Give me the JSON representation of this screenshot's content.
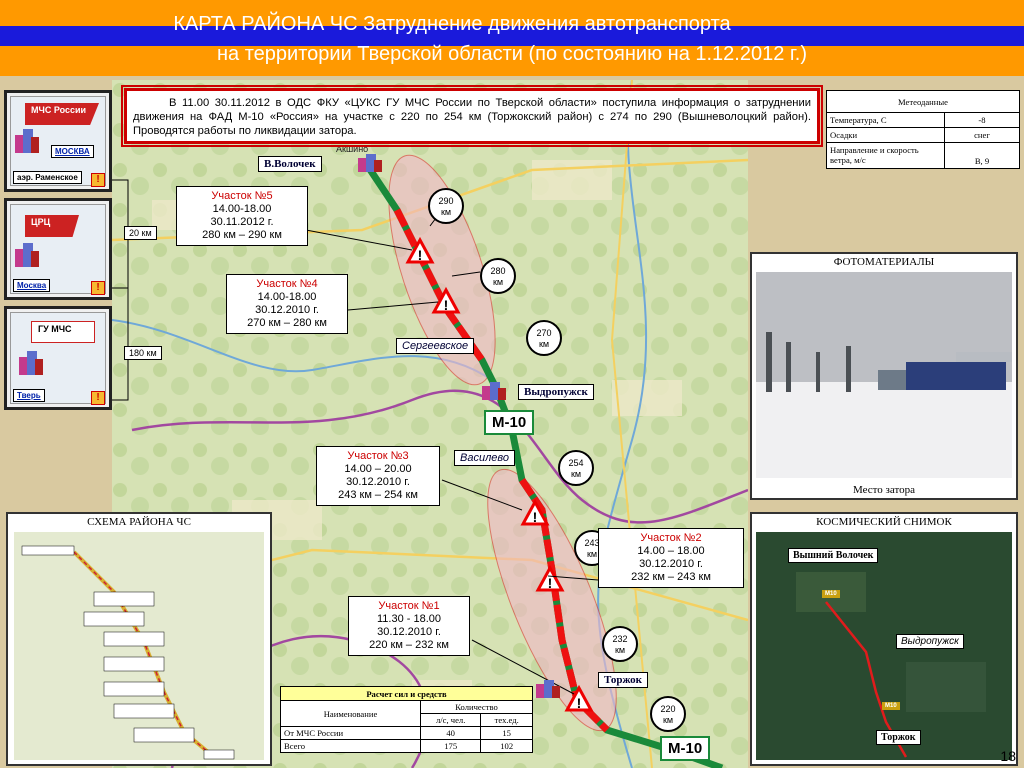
{
  "header": {
    "title_line1": "КАРТА РАЙОНА ЧС Затруднение движения автотранспорта",
    "title_line2": "на территории Тверской области (по состоянию на 1.12.2012 г.)"
  },
  "info_text": "В 11.00 30.11.2012 в ОДС ФКУ «ЦУКС ГУ МЧС России по Тверской  области» поступила информация о затруднении движения на ФАД М-10 «Россия» на участке с 220 по 254 км (Торжокский район) с 274 по 290 (Вышневолоцкий район). Проводятся работы по ликвидации затора.",
  "meteo": {
    "title": "Метеоданные",
    "rows": [
      {
        "label": "Температура, С",
        "value": "-8"
      },
      {
        "label": "Осадки",
        "value": "снег"
      },
      {
        "label": "Направление и скорость ветра, м/с",
        "value": "В, 9"
      }
    ]
  },
  "org_chain": {
    "box1": {
      "flag": "МЧС России",
      "place": "МОСКВА",
      "airport": "аэр. Раменское"
    },
    "box2": {
      "flag": "ЦРЦ",
      "place": "Москва"
    },
    "box3": {
      "flag": "ГУ МЧС",
      "place": "Тверь"
    },
    "dist1": "20 км",
    "dist2": "180 км",
    "warn_glyph": "!"
  },
  "map": {
    "towns": {
      "volochek": "В.Волочек",
      "sergeevskoe": "Сергеевское",
      "vydropuzhsk": "Выдропужск",
      "vasilevo": "Василево",
      "torzhok": "Торжок",
      "akshino": "Акшино"
    },
    "road_label": "М-10",
    "km_markers": [
      {
        "line1": "290",
        "line2": "км"
      },
      {
        "line1": "280",
        "line2": "км"
      },
      {
        "line1": "270",
        "line2": "км"
      },
      {
        "line1": "254",
        "line2": "км"
      },
      {
        "line1": "243",
        "line2": "км"
      },
      {
        "line1": "232",
        "line2": "км"
      },
      {
        "line1": "220",
        "line2": "км"
      }
    ],
    "sections": [
      {
        "title": "Участок №5",
        "time": "14.00-18.00",
        "date": "30.11.2012 г.",
        "range": "280 км – 290 км"
      },
      {
        "title": "Участок №4",
        "time": "14.00-18.00",
        "date": "30.12.2010 г.",
        "range": "270 км – 280 км"
      },
      {
        "title": "Участок №3",
        "time": "14.00 – 20.00",
        "date": "30.12.2010 г.",
        "range": "243 км – 254 км"
      },
      {
        "title": "Участок №2",
        "time": "14.00 – 18.00",
        "date": "30.12.2010 г.",
        "range": "232 км – 243 км"
      },
      {
        "title": "Участок №1",
        "time": "11.30 - 18.00",
        "date": "30.12.2010 г.",
        "range": "220 км – 232 км"
      }
    ]
  },
  "photo_panel": {
    "title": "ФОТОМАТЕРИАЛЫ",
    "caption": "Место затора"
  },
  "satellite_panel": {
    "title": "КОСМИЧЕСКИЙ СНИМОК",
    "labels": {
      "top": "Вышний Волочек",
      "mid": "Выдропужск",
      "bottom": "Торжок",
      "m1": "М10",
      "m2": "М10"
    }
  },
  "scheme_panel": {
    "title": "СХЕМА РАЙОНА ЧС"
  },
  "forces_table": {
    "title": "Расчет сил и средств",
    "col_name": "Наименование",
    "col_qty": "Количество",
    "col_people": "л/с, чел.",
    "col_units": "тех.ед.",
    "rows": [
      {
        "name": "От МЧС России",
        "people": "40",
        "units": "15"
      },
      {
        "name": "Всего",
        "people": "175",
        "units": "102"
      }
    ]
  },
  "page_number": "18",
  "colors": {
    "orange": "#ff9900",
    "blue": "#1a1adb",
    "jam_red": "#ee1111",
    "road_green": "#1a8a3a"
  }
}
